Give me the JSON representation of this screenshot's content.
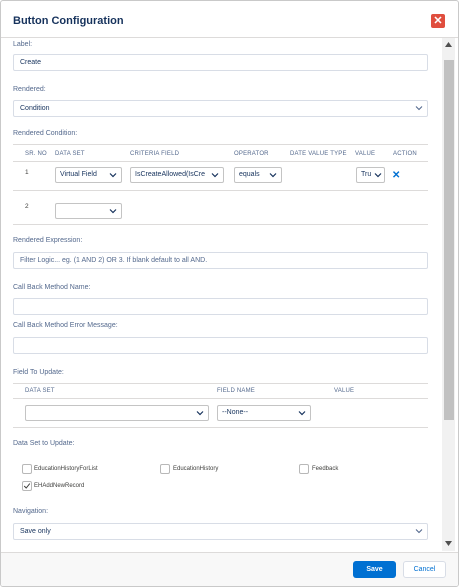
{
  "dialog": {
    "title": "Button Configuration",
    "close_icon": "close-icon",
    "accent_color": "#0070d2",
    "close_color": "#e04e3e"
  },
  "form": {
    "label_caption": "Label:",
    "label_value": "Create",
    "rendered_caption": "Rendered:",
    "rendered_value": "Condition",
    "rendered_condition_caption": "Rendered Condition:",
    "condition_table": {
      "headers": [
        "SR. NO",
        "DATA SET",
        "CRITERIA FIELD",
        "OPERATOR",
        "DATE VALUE TYPE",
        "VALUE",
        "ACTION"
      ],
      "rows": [
        {
          "sr": "1",
          "data_set": "Virtual Field",
          "criteria_field": "IsCreateAllowed(IsCre",
          "operator": "equals",
          "date_value_type": "",
          "value": "Tru",
          "action_icon": "delete-x-icon"
        },
        {
          "sr": "2",
          "data_set": "",
          "criteria_field": "",
          "operator": "",
          "date_value_type": "",
          "value": ""
        }
      ]
    },
    "rendered_expression_caption": "Rendered Expression:",
    "rendered_expression_placeholder": "Filter Logic... eg. (1 AND 2) OR 3. If blank default to all AND.",
    "callback_caption": "Call Back Method Name:",
    "callback_value": "",
    "callback_error_caption": "Call Back Method Error Message:",
    "callback_error_value": "",
    "field_to_update_caption": "Field To Update:",
    "field_table": {
      "headers": [
        "DATA SET",
        "FIELD NAME",
        "VALUE"
      ],
      "row": {
        "data_set": "",
        "field_name": "--None--",
        "value": ""
      }
    },
    "data_set_caption": "Data Set to Update:",
    "data_sets": [
      {
        "label": "EducationHistoryForList",
        "checked": false
      },
      {
        "label": "EducationHistory",
        "checked": false
      },
      {
        "label": "Feedback",
        "checked": false
      },
      {
        "label": "EHAddNewRecord",
        "checked": true
      }
    ],
    "navigation_caption": "Navigation:",
    "navigation_value": "Save only"
  },
  "footer": {
    "save_label": "Save",
    "cancel_label": "Cancel"
  }
}
